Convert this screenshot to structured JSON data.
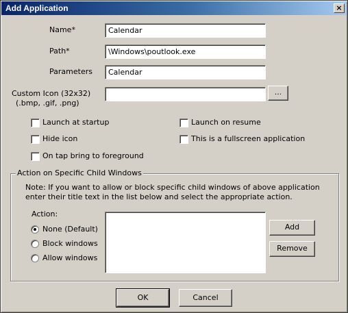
{
  "window": {
    "title": "Add Application",
    "close_glyph": "×"
  },
  "form": {
    "name_label": "Name*",
    "name_value": "Calendar",
    "path_label": "Path*",
    "path_value": "\\Windows\\poutlook.exe",
    "parameters_label": "Parameters",
    "parameters_value": "Calendar",
    "custom_icon_label_line1": "Custom Icon (32x32)",
    "custom_icon_label_line2": "(.bmp, .gif, .png)",
    "custom_icon_value": "",
    "browse_label": "..."
  },
  "options": {
    "launch_at_startup": {
      "label": "Launch at startup",
      "checked": false
    },
    "launch_on_resume": {
      "label": "Launch on resume",
      "checked": false
    },
    "hide_icon": {
      "label": "Hide icon",
      "checked": false
    },
    "fullscreen": {
      "label": "This is a fullscreen application",
      "checked": false
    },
    "bring_to_foreground": {
      "label": "On tap bring to foreground",
      "checked": false
    }
  },
  "child_windows": {
    "group_title": "Action on Specific Child Windows",
    "note_line1": "Note: If you want to allow or block specific child windows of above application",
    "note_line2": "enter their title text in the list below and select the appropriate action.",
    "action_label": "Action:",
    "radios": [
      {
        "label": "None (Default)",
        "selected": true
      },
      {
        "label": "Block windows",
        "selected": false
      },
      {
        "label": "Allow windows",
        "selected": false
      }
    ],
    "list_items": [],
    "add_label": "Add",
    "remove_label": "Remove"
  },
  "footer": {
    "ok_label": "OK",
    "cancel_label": "Cancel"
  },
  "colors": {
    "title_bar_start": "#0a246a",
    "title_bar_end": "#a6caf0",
    "dialog_face": "#d4d0c8"
  }
}
